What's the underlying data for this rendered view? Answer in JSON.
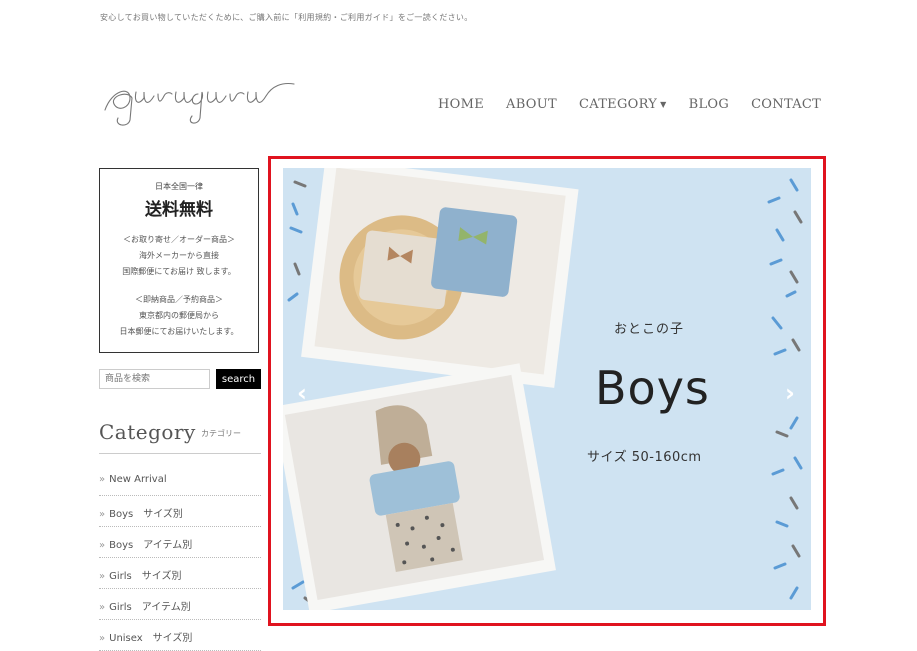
{
  "header": {
    "notice": "安心してお買い物していただくために、ご購入前に「利用規約・ご利用ガイド」をご一読ください。",
    "logo_text": "guruguru"
  },
  "nav": {
    "items": [
      {
        "label": "HOME"
      },
      {
        "label": "ABOUT"
      },
      {
        "label": "CATEGORY"
      },
      {
        "label": "BLOG"
      },
      {
        "label": "CONTACT"
      }
    ]
  },
  "sidebar": {
    "shipping": {
      "small": "日本全国一律",
      "big": "送料無料",
      "lines1": [
        "＜お取り寄せ／オーダー商品＞",
        "海外メーカーから直接",
        "国際郵便にてお届け 致します。"
      ],
      "lines2": [
        "＜即納商品／予約商品＞",
        "東京都内の郵便局から",
        "日本郵便にてお届けいたします。"
      ]
    },
    "search": {
      "placeholder": "商品を検索",
      "button": "search"
    },
    "category": {
      "title": "Category",
      "subtitle": "カテゴリー",
      "items": [
        "New Arrival",
        "Boys　サイズ別",
        "Boys　アイテム別",
        "Girls　サイズ別",
        "Girls　アイテム別",
        "Unisex　サイズ別"
      ]
    }
  },
  "banner": {
    "subtitle": "おとこの子",
    "title": "Boys",
    "size_text": "サイズ 50-160cm",
    "prev_arrow": "‹",
    "next_arrow": "›"
  },
  "colors": {
    "banner_bg": "#cfe3f2",
    "highlight": "#e0131f",
    "search_button": "#000000"
  }
}
